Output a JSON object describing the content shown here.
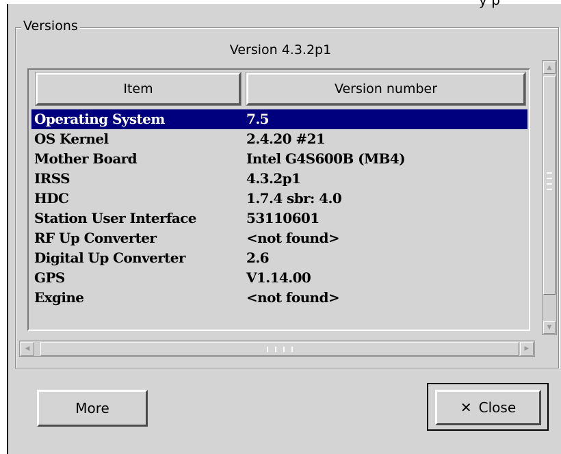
{
  "window": {
    "top_fragment": "y                           p"
  },
  "group": {
    "title": "Versions",
    "caption": "Version 4.3.2p1"
  },
  "table": {
    "columns": [
      "Item",
      "Version number"
    ],
    "rows": [
      {
        "item": "Operating System",
        "version": "7.5",
        "selected": true
      },
      {
        "item": "OS Kernel",
        "version": "2.4.20 #21"
      },
      {
        "item": "Mother Board",
        "version": "Intel G4S600B (MB4)"
      },
      {
        "item": "IRSS",
        "version": "4.3.2p1"
      },
      {
        "item": "HDC",
        "version": " 1.7.4 sbr: 4.0"
      },
      {
        "item": "Station User Interface",
        "version": "53110601"
      },
      {
        "item": "RF Up Converter",
        "version": "<not found>"
      },
      {
        "item": "Digital Up Converter",
        "version": "2.6"
      },
      {
        "item": "GPS",
        "version": "V1.14.00"
      },
      {
        "item": "Exgine",
        "version": "<not found>"
      }
    ]
  },
  "buttons": {
    "more": "More",
    "close": "Close"
  },
  "icons": {
    "close": "x-icon",
    "scroll_up": "arrow-up-icon",
    "scroll_down": "arrow-down-icon",
    "scroll_left": "arrow-left-icon",
    "scroll_right": "arrow-right-icon"
  },
  "colors": {
    "selection": "#00007f",
    "background": "#d4d4d4"
  }
}
